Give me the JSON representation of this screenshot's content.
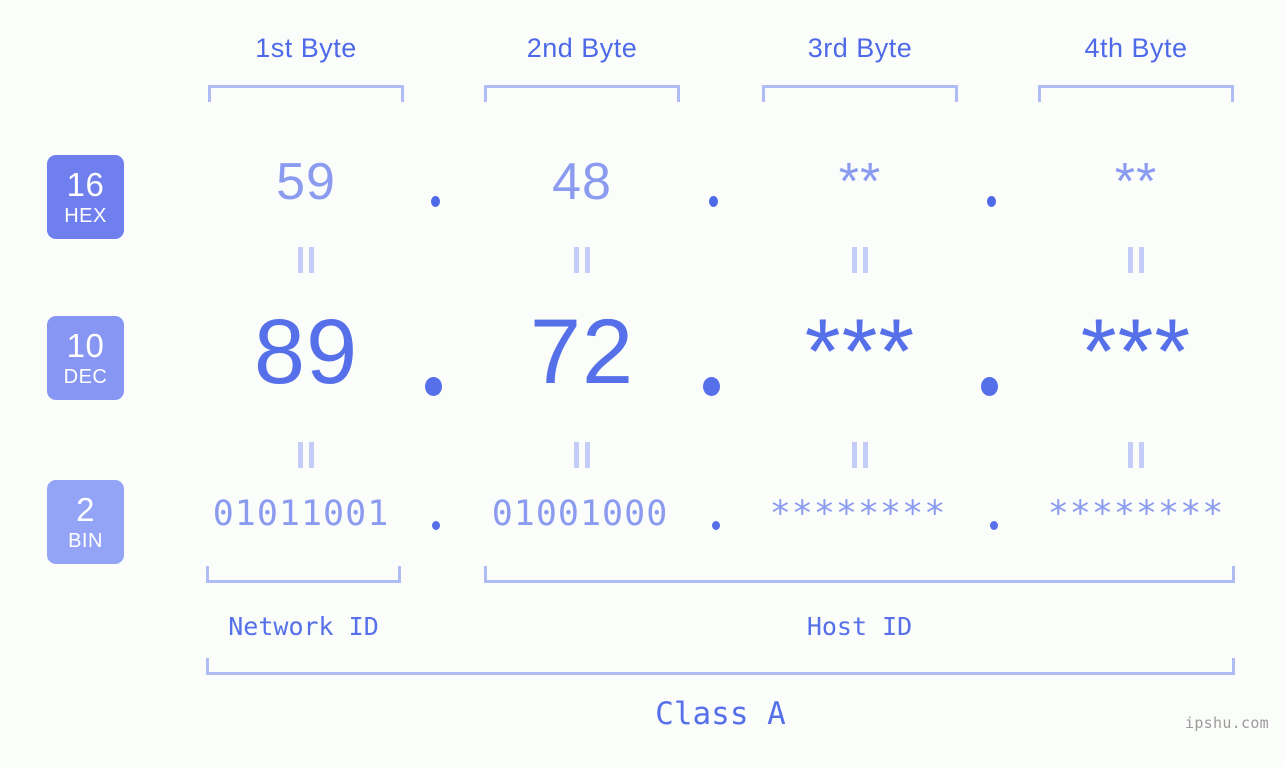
{
  "page": {
    "background_color": "#fbfdfa",
    "watermark": "ipshu.com",
    "class_label": "Class A"
  },
  "colors": {
    "accent_strong": "#5570e8",
    "accent_label": "#4e6ae8",
    "accent_light": "#8b9cf0",
    "bracket": "#b0bdf5",
    "equals": "#c3cdf7",
    "badge_hex": "#6f80ee",
    "badge_dec": "#8796f2",
    "badge_bin": "#93a4f6",
    "watermark": "#9b9b9b"
  },
  "byte_headers": [
    {
      "label": "1st Byte"
    },
    {
      "label": "2nd Byte"
    },
    {
      "label": "3rd Byte"
    },
    {
      "label": "4th Byte"
    }
  ],
  "bases": [
    {
      "number": "16",
      "name": "HEX"
    },
    {
      "number": "10",
      "name": "DEC"
    },
    {
      "number": "2",
      "name": "BIN"
    }
  ],
  "rows": {
    "hex": {
      "base_number": "16",
      "base_name": "HEX",
      "values": [
        "59",
        "48",
        "**",
        "**"
      ],
      "separators": [
        ".",
        ".",
        "."
      ]
    },
    "dec": {
      "base_number": "10",
      "base_name": "DEC",
      "values": [
        "89",
        "72",
        "***",
        "***"
      ],
      "separators": [
        ".",
        ".",
        "."
      ]
    },
    "bin": {
      "base_number": "2",
      "base_name": "BIN",
      "values": [
        "01011001",
        "01001000",
        "********",
        "********"
      ],
      "separators": [
        ".",
        ".",
        "."
      ]
    }
  },
  "equality_marks": {
    "hex_to_dec": "=",
    "dec_to_bin": "="
  },
  "id_sections": [
    {
      "label": "Network ID"
    },
    {
      "label": "Host ID"
    }
  ]
}
